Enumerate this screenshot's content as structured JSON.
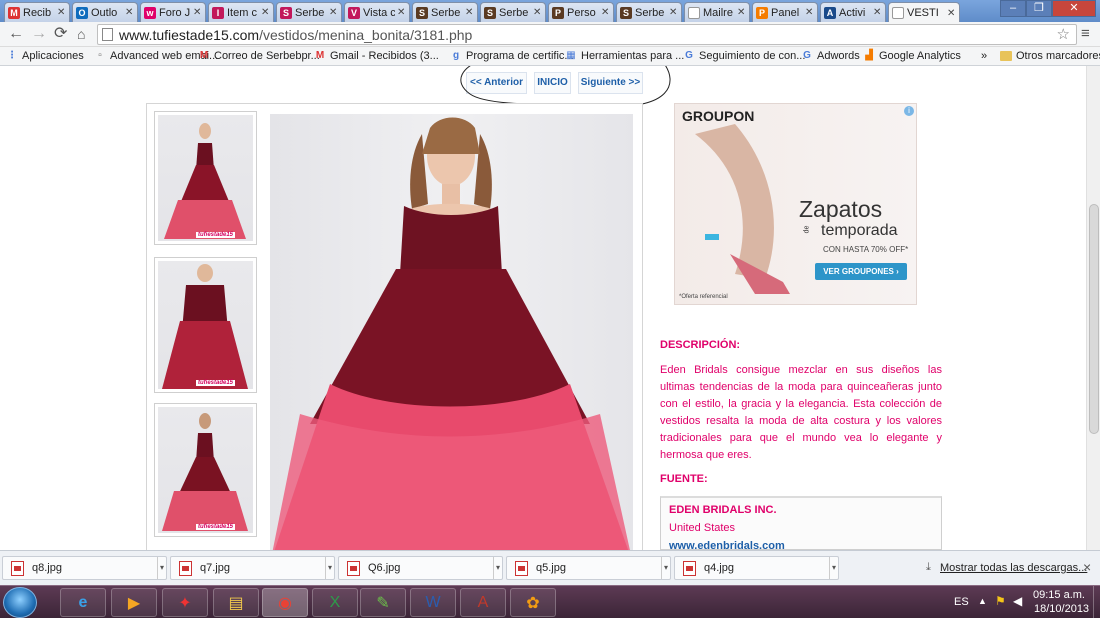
{
  "tabs": [
    {
      "label": "Recib",
      "icon": "gmail-icon",
      "color": "#d33",
      "glyph": "M"
    },
    {
      "label": "Outlo",
      "icon": "outlook-icon",
      "color": "#0f6cbd",
      "glyph": "O"
    },
    {
      "label": "Foro J",
      "icon": "forum-icon",
      "color": "#e0006a",
      "glyph": "w"
    },
    {
      "label": "Item c",
      "icon": "site-icon",
      "color": "#c2185b",
      "glyph": "I"
    },
    {
      "label": "Serbe",
      "icon": "site-icon",
      "color": "#c2185b",
      "glyph": "S"
    },
    {
      "label": "Vista c",
      "icon": "site-icon",
      "color": "#c2185b",
      "glyph": "V"
    },
    {
      "label": "Serbe",
      "icon": "butterfly-icon",
      "color": "#5a3a22",
      "glyph": "S"
    },
    {
      "label": "Serbe",
      "icon": "butterfly-icon",
      "color": "#5a3a22",
      "glyph": "S"
    },
    {
      "label": "Perso",
      "icon": "butterfly-icon",
      "color": "#5a3a22",
      "glyph": "P"
    },
    {
      "label": "Serbe",
      "icon": "butterfly-icon",
      "color": "#5a3a22",
      "glyph": "S"
    },
    {
      "label": "Mailre",
      "icon": "page-icon",
      "color": "#888",
      "glyph": ""
    },
    {
      "label": "Panel",
      "icon": "panel-icon",
      "color": "#f57c00",
      "glyph": "P"
    },
    {
      "label": "Activi",
      "icon": "activity-icon",
      "color": "#1a4a8a",
      "glyph": "A"
    },
    {
      "label": "VESTI",
      "icon": "page-icon",
      "color": "#888",
      "glyph": ""
    }
  ],
  "toolbar": {
    "url_domain": "www.tufiestade15.com",
    "url_path": "/vestidos/menina_bonita/3181.php"
  },
  "bookmarks": [
    {
      "label": "Aplicaciones",
      "icon": "apps-icon",
      "color": "#4a7bd8",
      "glyph": "⋮"
    },
    {
      "label": "Advanced web emai...",
      "icon": "page-icon",
      "color": "#666",
      "glyph": "▫"
    },
    {
      "label": "Correo de Serbebpr...",
      "icon": "gmail-icon",
      "color": "#d33",
      "glyph": "M"
    },
    {
      "label": "Gmail - Recibidos (3...",
      "icon": "gmail-icon",
      "color": "#d33",
      "glyph": "M"
    },
    {
      "label": "Programa de certific...",
      "icon": "google-icon",
      "color": "#4a7bd8",
      "glyph": "g"
    },
    {
      "label": "Herramientas para ...",
      "icon": "tools-icon",
      "color": "#4a7bd8",
      "glyph": "▦"
    },
    {
      "label": "Seguimiento de con...",
      "icon": "google-icon",
      "color": "#4a7bd8",
      "glyph": "G"
    },
    {
      "label": "Adwords",
      "icon": "google-icon",
      "color": "#4a7bd8",
      "glyph": "G"
    },
    {
      "label": "Google Analytics",
      "icon": "analytics-icon",
      "color": "#f57c00",
      "glyph": "▟"
    }
  ],
  "other_bookmarks": "Otros marcadores",
  "bookmarks_more": "»",
  "page": {
    "nav": {
      "prev": "<< Anterior",
      "home": "INICIO",
      "next": "Siguiente >>"
    },
    "thumb_logo": "tufiestade15",
    "ad": {
      "brand": "GROUPON",
      "headline": "Zapatos",
      "connector": "de",
      "subline": "temporada",
      "small": "CON HASTA 70% OFF*",
      "cta": "VER GROUPONES ›",
      "note": "*Oferta referencial"
    },
    "description_title": "DESCRIPCIÓN:",
    "description": "Eden Bridals consigue mezclar en sus diseños las ultimas tendencias de la moda para quinceañeras junto con el estilo, la gracia y la elegancia. Esta colección de vestidos resalta la moda de alta costura y los valores tradicionales para que el mundo vea lo elegante y hermosa que eres.",
    "source_title": "FUENTE:",
    "source": {
      "company": "EDEN BRIDALS INC.",
      "country": "United States",
      "url": "www.edenbridals.com"
    }
  },
  "downloads": {
    "items": [
      "q8.jpg",
      "q7.jpg",
      "Q6.jpg",
      "q5.jpg",
      "q4.jpg"
    ],
    "show_all": "Mostrar todas las descargas...",
    "close": "×"
  },
  "taskbar": {
    "language": "ES",
    "time": "09:15 a.m.",
    "date": "18/10/2013"
  },
  "colors": {
    "accent_pink": "#e0006a",
    "link_blue": "#1e5fa8",
    "taskbar": "#4a2e44"
  }
}
